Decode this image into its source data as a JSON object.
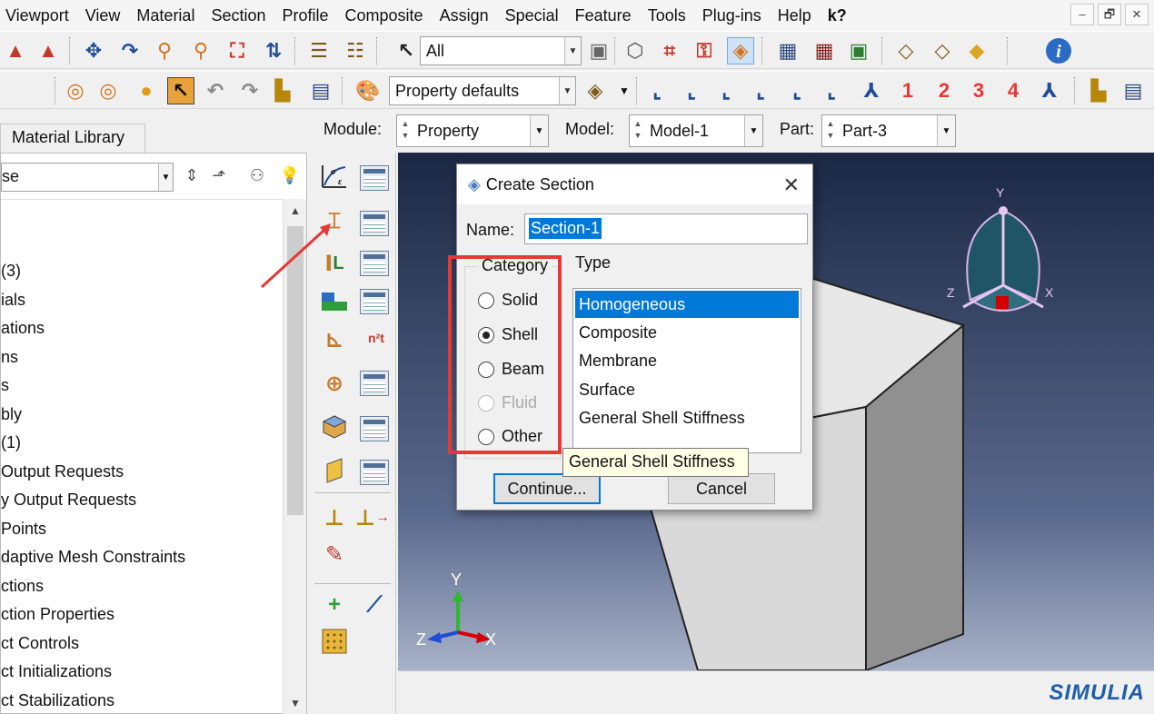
{
  "menu": [
    "Viewport",
    "View",
    "Material",
    "Section",
    "Profile",
    "Composite",
    "Assign",
    "Special",
    "Feature",
    "Tools",
    "Plug-ins",
    "Help",
    "k?"
  ],
  "window_controls": [
    "–",
    "🗗",
    "✕"
  ],
  "toolbar1": {
    "selection_filter": "All",
    "icons": [
      "save-model-icon",
      "save-model-database-icon",
      "pan-icon",
      "rotate-icon",
      "zoom-icon",
      "box-zoom-icon",
      "auto-fit-icon",
      "cycle-views-icon",
      "align-icon",
      "assembly-icon",
      "select-icon",
      "selection-options-icon",
      "view-cube-icon",
      "datum-icon",
      "query-icon",
      "iso-view-icon",
      "render-wireframe-icon",
      "render-hidden-icon",
      "render-shaded-icon",
      "perspective-icon",
      "parallel-icon",
      "solid-icon",
      "info-icon"
    ]
  },
  "toolbar2": {
    "color_code": "Property defaults",
    "view_labels": [
      "1",
      "2",
      "3",
      "4"
    ],
    "icons": [
      "create-display-group-icon",
      "replace-icon",
      "remove-icon",
      "color-code-icon",
      "undo-icon",
      "redo-icon",
      "query-icon",
      "view-manager-icon",
      "palette-icon",
      "box-display-icon",
      "front-view-icon",
      "back-view-icon",
      "left-view-icon",
      "right-view-icon",
      "top-view-icon",
      "bottom-view-icon",
      "iso-view-icon",
      "triad-icon",
      "transparency-icon",
      "view-manager-icon-2"
    ]
  },
  "module_bar": {
    "module_label": "Module:",
    "module_value": "Property",
    "model_label": "Model:",
    "model_value": "Model-1",
    "part_label": "Part:",
    "part_value": "Part-3"
  },
  "tree": {
    "tab_label": "Material Library",
    "filter_value": "se",
    "items": [
      "(3)",
      "ials",
      "ations",
      "ns",
      "s",
      "bly",
      "(1)",
      "Output Requests",
      "y Output Requests",
      "Points",
      "daptive Mesh Constraints",
      "ctions",
      "ction Properties",
      "ct Controls",
      "ct Initializations",
      "ct Stabilizations"
    ]
  },
  "toolbox": {
    "icons": [
      "create-material-icon",
      "create-section-icon",
      "create-profile-icon",
      "assign-section-icon",
      "assign-beam-orientation-icon",
      "assign-normal-icon",
      "special-icon",
      "composite-layup-icon",
      "skin-icon",
      "inertia-icon",
      "springs-icon",
      "stringer-icon",
      "datum-point-icon",
      "datum-axis-icon",
      "grid-icon"
    ]
  },
  "viewport": {
    "triad_labels": {
      "y": "Y",
      "z": "Z",
      "x": "X"
    },
    "csys_labels": {
      "y": "Y",
      "z": "Z",
      "x": "X"
    },
    "brand": "SIMULIA"
  },
  "dialog": {
    "title": "Create Section",
    "name_label": "Name:",
    "name_value": "Section-1",
    "category_legend": "Category",
    "categories": [
      {
        "label": "Solid",
        "state": "off"
      },
      {
        "label": "Shell",
        "state": "on"
      },
      {
        "label": "Beam",
        "state": "off"
      },
      {
        "label": "Fluid",
        "state": "disabled"
      },
      {
        "label": "Other",
        "state": "off"
      }
    ],
    "type_legend": "Type",
    "types": [
      "Homogeneous",
      "Composite",
      "Membrane",
      "Surface",
      "General Shell Stiffness"
    ],
    "selected_type": "Homogeneous",
    "continue_label": "Continue...",
    "cancel_label": "Cancel"
  },
  "tooltip": "General Shell Stiffness",
  "colors": {
    "accent": "#0078d7",
    "highlight": "#e53935",
    "viewport_top": "#1b2844",
    "viewport_bottom": "#a8b2c8"
  }
}
